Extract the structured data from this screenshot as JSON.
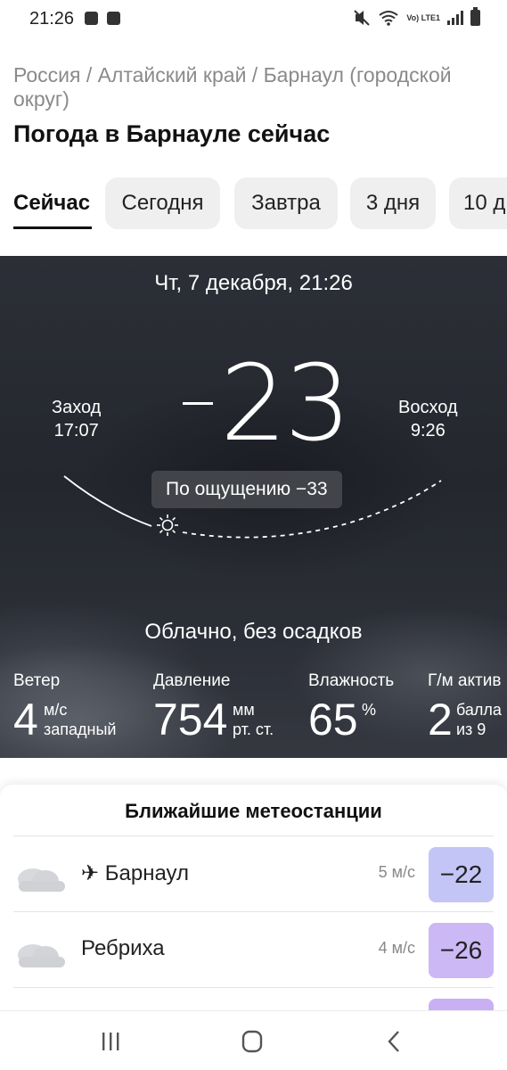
{
  "status_bar": {
    "time": "21:26",
    "lte_label": "Vo) LTE1"
  },
  "breadcrumb": "Россия / Алтайский край / Барнаул (городской округ)",
  "page_title": "Погода в Барнауле сейчас",
  "tabs": [
    {
      "label": "Сейчас",
      "active": true
    },
    {
      "label": "Сегодня",
      "active": false
    },
    {
      "label": "Завтра",
      "active": false
    },
    {
      "label": "3 дня",
      "active": false
    },
    {
      "label": "10 д",
      "active": false
    }
  ],
  "current": {
    "datetime": "Чт, 7 декабря, 21:26",
    "sunset_label": "Заход",
    "sunset_time": "17:07",
    "sunrise_label": "Восход",
    "sunrise_time": "9:26",
    "temperature": "23",
    "feels_like": "По ощущению −33",
    "condition": "Облачно, без осадков",
    "sun_icon": "sun-icon",
    "metrics": {
      "wind": {
        "label": "Ветер",
        "value": "4",
        "unit": "м/с",
        "sub": "западный"
      },
      "pressure": {
        "label": "Давление",
        "value": "754",
        "unit": "мм",
        "sub": "рт. ст."
      },
      "humidity": {
        "label": "Влажность",
        "value": "65",
        "unit": "%"
      },
      "geomagnetic": {
        "label": "Г/м актив",
        "value": "2",
        "unit": "балла",
        "sub": "из 9"
      }
    }
  },
  "stations": {
    "title": "Ближайшие метеостанции",
    "items": [
      {
        "icon": "cloudy-night-icon",
        "prefix_icon": "airplane-icon",
        "name": "Барнаул",
        "wind": "5 м/с",
        "temp": "−22",
        "color": "#c4c5f7"
      },
      {
        "icon": "cloudy-night-icon",
        "name": "Ребриха",
        "wind": "4 м/с",
        "temp": "−26",
        "color": "#cbb8f5"
      },
      {
        "icon": "cloudy-night-icon",
        "name": "",
        "wind": "",
        "temp": "",
        "color": "#c9b0f3"
      }
    ]
  },
  "colors": {
    "hero_bg": "#2c2f37",
    "station_temp_1": "#c4c5f7",
    "station_temp_2": "#cbb8f5"
  }
}
